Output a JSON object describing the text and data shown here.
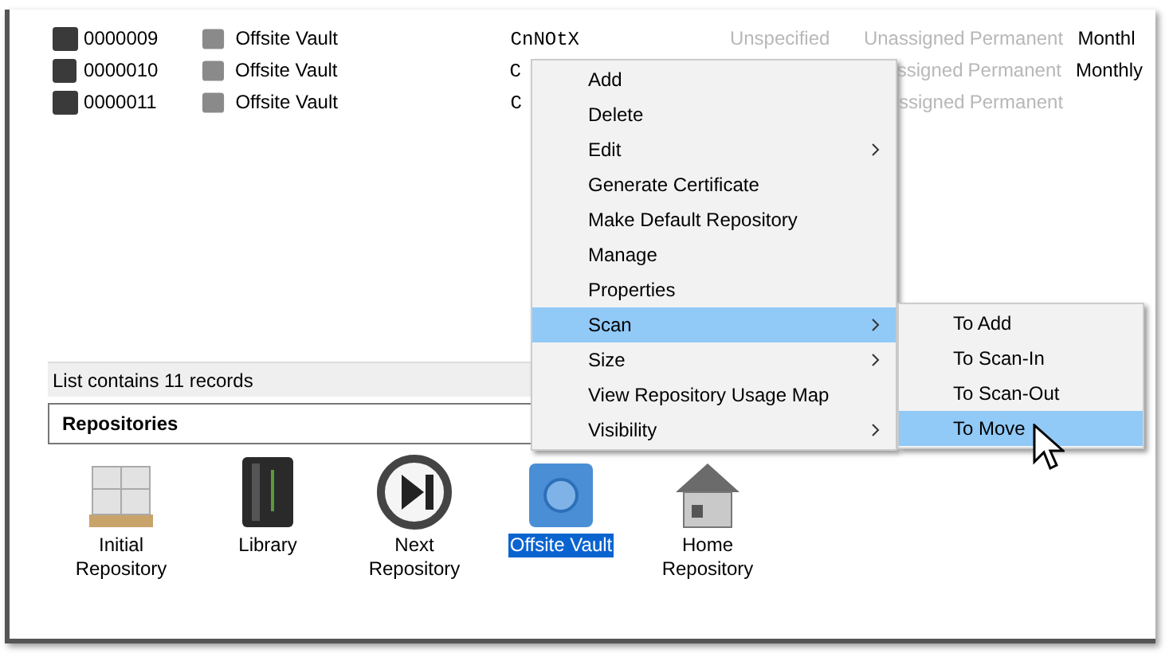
{
  "records": [
    {
      "id": "0000009",
      "location": "Offsite Vault",
      "column_3": "CnNOtX",
      "column_4": "Unspecified",
      "column_5": "Unassigned",
      "column_6": "Permanent",
      "column_7": "Monthl"
    },
    {
      "id": "0000010",
      "location": "Offsite Vault",
      "column_3": "C",
      "column_5": "ssigned",
      "column_6": "Permanent",
      "column_7": "Monthly"
    },
    {
      "id": "0000011",
      "location": "Offsite Vault",
      "column_3": "C",
      "column_5": "ssigned",
      "column_6": "Permanent"
    }
  ],
  "status": "List contains 11 records",
  "repositories": {
    "title": "Repositories",
    "items": [
      {
        "label": "Initial Repository",
        "kind": "boxes",
        "selected": false
      },
      {
        "label": "Library",
        "kind": "library",
        "selected": false
      },
      {
        "label": "Next Repository",
        "kind": "next",
        "selected": false
      },
      {
        "label": "Offsite Vault",
        "kind": "vault",
        "selected": true
      },
      {
        "label": "Home Repository",
        "kind": "home",
        "selected": false
      }
    ]
  },
  "context_menu": [
    {
      "label": "Add",
      "submenu": false,
      "selected": false
    },
    {
      "label": "Delete",
      "submenu": false,
      "selected": false
    },
    {
      "label": "Edit",
      "submenu": true,
      "selected": false
    },
    {
      "label": "Generate Certificate",
      "submenu": false,
      "selected": false
    },
    {
      "label": "Make Default Repository",
      "submenu": false,
      "selected": false
    },
    {
      "label": "Manage",
      "submenu": false,
      "selected": false
    },
    {
      "label": "Properties",
      "submenu": false,
      "selected": false
    },
    {
      "label": "Scan",
      "submenu": true,
      "selected": true
    },
    {
      "label": "Size",
      "submenu": true,
      "selected": false
    },
    {
      "label": "View Repository Usage Map",
      "submenu": false,
      "selected": false
    },
    {
      "label": "Visibility",
      "submenu": true,
      "selected": false
    }
  ],
  "submenu": [
    {
      "label": "To Add",
      "selected": false
    },
    {
      "label": "To Scan-In",
      "selected": false
    },
    {
      "label": "To Scan-Out",
      "selected": false
    },
    {
      "label": "To Move",
      "selected": true
    }
  ]
}
